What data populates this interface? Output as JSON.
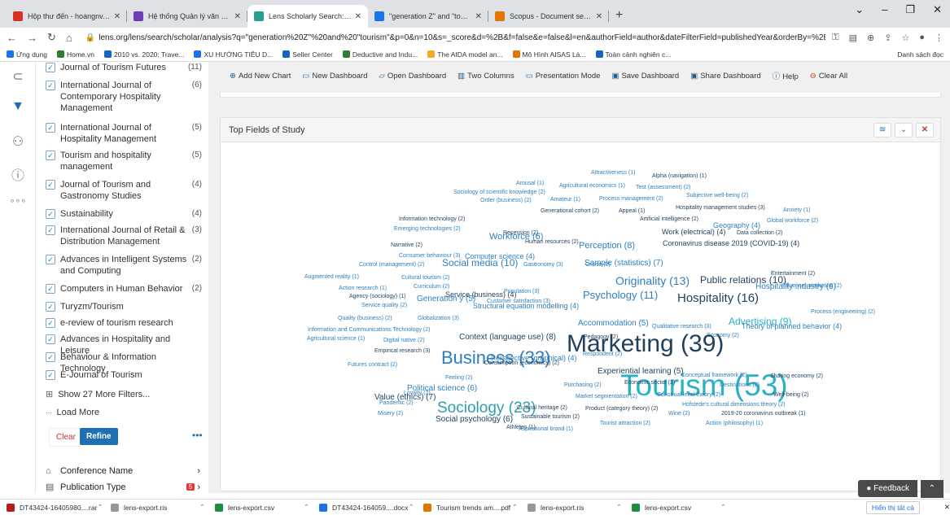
{
  "browser": {
    "tabs": [
      {
        "title": "Hộp thư đến - hoangnv.svhttdl@",
        "color": "#d93025",
        "active": false
      },
      {
        "title": "Hệ thống Quản lý văn bản và Đi",
        "color": "#6a3fb5",
        "active": false
      },
      {
        "title": "Lens Scholarly Search: \"generatio",
        "color": "#2a9d8f",
        "active": true
      },
      {
        "title": "\"generation Z\" and \"tourism\" - G",
        "color": "#1a73e8",
        "active": false
      },
      {
        "title": "Scopus - Document search result",
        "color": "#e37400",
        "active": false
      }
    ],
    "new_tab": "+",
    "url": "lens.org/lens/search/scholar/analysis?q=\"generation%20Z\"%20and%20\"tourism\"&p=0&n=10&s=_score&d=%2B&f=false&e=false&l=en&authorField=author&dateFilterField=publishedYear&orderBy=%2B_score&presentation=false&previe...",
    "bookmarks": [
      "Ứng dụng",
      "Home.vn",
      "2010 vs. 2020: Trave...",
      "XU HƯỚNG TIÊU D...",
      "Seller Center",
      "Deductive and Indu...",
      "The AIDA model an...",
      "Mô Hình AISAS Là...",
      "Toàn cảnh nghiên c..."
    ],
    "bookmarks_right": "Danh sách đọc"
  },
  "sidebar": {
    "filters": [
      {
        "label": "Journal of Tourism Futures",
        "count": "(11)"
      },
      {
        "label": "International Journal of Contemporary Hospitality Management",
        "count": "(6)"
      },
      {
        "label": "International Journal of Hospitality Management",
        "count": "(5)"
      },
      {
        "label": "Tourism and hospitality management",
        "count": "(5)"
      },
      {
        "label": "Journal of Tourism and Gastronomy Studies",
        "count": "(4)"
      },
      {
        "label": "Sustainability",
        "count": "(4)"
      },
      {
        "label": "International Journal of Retail & Distribution Management",
        "count": "(3)"
      },
      {
        "label": "Advances in Intelligent Systems and Computing",
        "count": "(2)"
      },
      {
        "label": "Computers in Human Behavior",
        "count": "(2)"
      },
      {
        "label": "Turyzm/Tourism",
        "count": ""
      },
      {
        "label": "e-review of tourism research",
        "count": ""
      },
      {
        "label": "Advances in Hospitality and Leisure",
        "count": ""
      },
      {
        "label": "Behaviour & Information Technology",
        "count": ""
      },
      {
        "label": "E-Journal of Tourism",
        "count": ""
      }
    ],
    "show_more": "Show 27 More Filters...",
    "load_more": "Load More",
    "clear_label": "Clear",
    "refine_label": "Refine",
    "conference_name": "Conference Name",
    "publication_type": "Publication Type",
    "pub_badge": "5"
  },
  "toolbar": {
    "items": [
      "Add New Chart",
      "New Dashboard",
      "Open Dashboard",
      "Two Columns",
      "Presentation Mode",
      "Save Dashboard",
      "Share Dashboard",
      "Help",
      "Clear All"
    ]
  },
  "panel": {
    "title": "Top Fields of Study"
  },
  "wordcloud": [
    {
      "t": "Tourism (53)",
      "c": "#2bb0c4"
    },
    {
      "t": "Marketing (39)",
      "c": "#1f3f5c"
    },
    {
      "t": "Business (33)",
      "c": "#2d7fc0"
    },
    {
      "t": "Sociology (23)",
      "c": "#2d9fb0"
    },
    {
      "t": "Hospitality (16)",
      "c": "#1f3f5c"
    },
    {
      "t": "Originality (13)",
      "c": "#2d7fc0"
    },
    {
      "t": "Psychology (11)",
      "c": "#2d7fc0"
    },
    {
      "t": "Public relations (10)",
      "c": "#1f3f5c"
    },
    {
      "t": "Social media (10)",
      "c": "#2d7fc0"
    },
    {
      "t": "Advertising (9)",
      "c": "#2bb0c4"
    },
    {
      "t": "Context (language use) (8)",
      "c": "#1f3f5c"
    },
    {
      "t": "Perception (8)",
      "c": "#2d7fc0"
    },
    {
      "t": "Sample (statistics) (7)",
      "c": "#2d7fc0"
    },
    {
      "t": "Value (ethics) (7)",
      "c": "#1f3f5c"
    },
    {
      "t": "Workforce (6)",
      "c": "#2d7fc0"
    },
    {
      "t": "Hospitality industry (6)",
      "c": "#2d7fc0"
    },
    {
      "t": "Political science (6)",
      "c": "#2d7fc0"
    },
    {
      "t": "Social psychology (6)",
      "c": "#1f3f5c"
    },
    {
      "t": "Generation y (5)",
      "c": "#2d7fc0"
    },
    {
      "t": "Accommodation (5)",
      "c": "#2d7fc0"
    },
    {
      "t": "Experiential learning (5)",
      "c": "#1f3f5c"
    },
    {
      "t": "Geography (4)",
      "c": "#2d7fc0"
    },
    {
      "t": "Work (electrical) (4)",
      "c": "#1f3f5c"
    },
    {
      "t": "Coronavirus disease 2019 (COVID-19) (4)",
      "c": "#1f3f5c"
    },
    {
      "t": "Service (business) (4)",
      "c": "#1f3f5c"
    },
    {
      "t": "Computer science (4)",
      "c": "#2d7fc0"
    },
    {
      "t": "Structural equation modelling (4)",
      "c": "#2d7fc0"
    },
    {
      "t": "Perspective (graphical) (4)",
      "c": "#2d7fc0"
    },
    {
      "t": "Theory of planned behavior (4)",
      "c": "#2d7fc0"
    },
    {
      "t": "Alpha (navigation) (1)",
      "c": "#1f3f5c"
    },
    {
      "t": "Attractiveness (1)",
      "c": "#2d7fc0"
    },
    {
      "t": "Arousal (1)",
      "c": "#2d7fc0"
    },
    {
      "t": "Agricultural economics (1)",
      "c": "#2d7fc0"
    },
    {
      "t": "Test (assessment) (2)",
      "c": "#2d7fc0"
    },
    {
      "t": "Sociology of scientific knowledge (2)",
      "c": "#2d7fc0"
    },
    {
      "t": "Subjective well-being (2)",
      "c": "#2d7fc0"
    },
    {
      "t": "Order (business) (2)",
      "c": "#2d7fc0"
    },
    {
      "t": "Amateur (1)",
      "c": "#2d7fc0"
    },
    {
      "t": "Process management (2)",
      "c": "#2d7fc0"
    },
    {
      "t": "Generational cohort (2)",
      "c": "#1f3f5c"
    },
    {
      "t": "Appeal (1)",
      "c": "#1f3f5c"
    },
    {
      "t": "Hospitality management studies (3)",
      "c": "#1f3f5c"
    },
    {
      "t": "Anxiety (1)",
      "c": "#2d7fc0"
    },
    {
      "t": "Information technology (2)",
      "c": "#1f3f5c"
    },
    {
      "t": "Artificial intelligence (2)",
      "c": "#1f3f5c"
    },
    {
      "t": "Global workforce (2)",
      "c": "#2d7fc0"
    },
    {
      "t": "Emerging technologies (2)",
      "c": "#2d7fc0"
    },
    {
      "t": "Recession (2)",
      "c": "#1f3f5c"
    },
    {
      "t": "Data collection (2)",
      "c": "#1f3f5c"
    },
    {
      "t": "Narrative (2)",
      "c": "#1f3f5c"
    },
    {
      "t": "Human resources (2)",
      "c": "#1f3f5c"
    },
    {
      "t": "Consumer behaviour (3)",
      "c": "#2d7fc0"
    },
    {
      "t": "Control (management) (2)",
      "c": "#2d7fc0"
    },
    {
      "t": "Gastronomy (3)",
      "c": "#2d7fc0"
    },
    {
      "t": "Cruise (2)",
      "c": "#2d7fc0"
    },
    {
      "t": "Entertainment (2)",
      "c": "#1f3f5c"
    },
    {
      "t": "Augmented reality (1)",
      "c": "#2d7fc0"
    },
    {
      "t": "Cultural tourism (2)",
      "c": "#2d7fc0"
    },
    {
      "t": "Influencer marketing (2)",
      "c": "#2d7fc0"
    },
    {
      "t": "Action research (1)",
      "c": "#2d7fc0"
    },
    {
      "t": "Curriculum (2)",
      "c": "#2d7fc0"
    },
    {
      "t": "Population (3)",
      "c": "#2d7fc0"
    },
    {
      "t": "Agency (sociology) (1)",
      "c": "#1f3f5c"
    },
    {
      "t": "Customer satisfaction (3)",
      "c": "#2d7fc0"
    },
    {
      "t": "Service quality (2)",
      "c": "#2d7fc0"
    },
    {
      "t": "Process (engineering) (2)",
      "c": "#2d7fc0"
    },
    {
      "t": "Quality (business) (2)",
      "c": "#2d7fc0"
    },
    {
      "t": "Globalization (3)",
      "c": "#2d7fc0"
    },
    {
      "t": "Information and Communications Technology (2)",
      "c": "#2d7fc0"
    },
    {
      "t": "Qualitative research (3)",
      "c": "#2d7fc0"
    },
    {
      "t": "Agricultural science (1)",
      "c": "#2d7fc0"
    },
    {
      "t": "Digital native (2)",
      "c": "#2d7fc0"
    },
    {
      "t": "Pedagogy (2)",
      "c": "#1f3f5c"
    },
    {
      "t": "Economy (2)",
      "c": "#2d7fc0"
    },
    {
      "t": "Empirical research (3)",
      "c": "#1f3f5c"
    },
    {
      "t": "Respondent (2)",
      "c": "#2d7fc0"
    },
    {
      "t": "Futures contract (2)",
      "c": "#2d7fc0"
    },
    {
      "t": "Consumption (economics) (2)",
      "c": "#1f3f5c"
    },
    {
      "t": "Conceptual framework (2)",
      "c": "#2d7fc0"
    },
    {
      "t": "Sharing economy (2)",
      "c": "#1f3f5c"
    },
    {
      "t": "Feeling (2)",
      "c": "#2d7fc0"
    },
    {
      "t": "Economic sector (2)",
      "c": "#1f3f5c"
    },
    {
      "t": "Destinations (2)",
      "c": "#2d7fc0"
    },
    {
      "t": "Purchasing (2)",
      "c": "#2d7fc0"
    },
    {
      "t": "Loyalty (2)",
      "c": "#2d7fc0"
    },
    {
      "t": "Market segmentation (2)",
      "c": "#2d7fc0"
    },
    {
      "t": "Construal level theory (2)",
      "c": "#2d7fc0"
    },
    {
      "t": "Well-being (2)",
      "c": "#1f3f5c"
    },
    {
      "t": "Pandemic (2)",
      "c": "#2d7fc0"
    },
    {
      "t": "Hofstede's cultural dimensions theory (2)",
      "c": "#2d7fc0"
    },
    {
      "t": "Cultural heritage (2)",
      "c": "#1f3f5c"
    },
    {
      "t": "Product (category theory) (2)",
      "c": "#1f3f5c"
    },
    {
      "t": "Wine (2)",
      "c": "#2d7fc0"
    },
    {
      "t": "2019-20 coronavirus outbreak (1)",
      "c": "#1f3f5c"
    },
    {
      "t": "Misery (2)",
      "c": "#2d7fc0"
    },
    {
      "t": "Sustainable tourism (2)",
      "c": "#1f3f5c"
    },
    {
      "t": "Tourist attraction (2)",
      "c": "#2d7fc0"
    },
    {
      "t": "Action (philosophy) (1)",
      "c": "#2d7fc0"
    },
    {
      "t": "Athletes (1)",
      "c": "#1f3f5c"
    },
    {
      "t": "Aspirational brand (1)",
      "c": "#2d7fc0"
    }
  ],
  "footer": {
    "feedback": "Feedback",
    "downloads": [
      {
        "name": "DT43424-16405980....rar",
        "color": "#b71c1c"
      },
      {
        "name": "lens-export.ris",
        "color": "#999999"
      },
      {
        "name": "lens-export.csv",
        "color": "#1e8e3e"
      },
      {
        "name": "DT43424-164059....docx",
        "color": "#1a73e8"
      },
      {
        "name": "Tourism trends am....pdf",
        "color": "#e37400"
      },
      {
        "name": "lens-export.ris",
        "color": "#999999"
      },
      {
        "name": "lens-export.csv",
        "color": "#1e8e3e"
      }
    ],
    "show_all": "Hiển thị tất cả"
  }
}
